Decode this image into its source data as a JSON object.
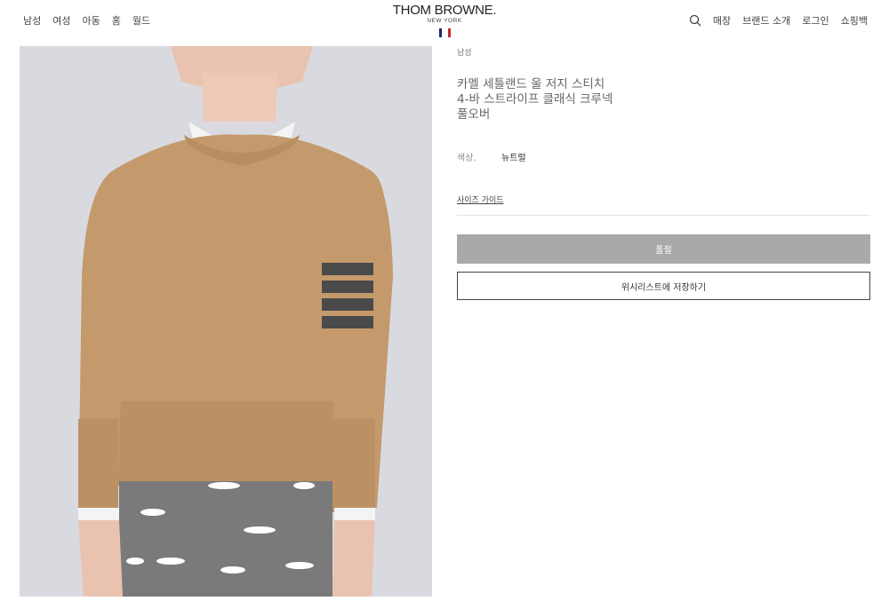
{
  "header": {
    "nav_left": [
      "남성",
      "여성",
      "아동",
      "홈",
      "월드"
    ],
    "logo": {
      "main": "THOM BROWNE.",
      "sub": "NEW YORK"
    },
    "flag_colors": [
      "#1d2a6d",
      "#ffffff",
      "#c1272d"
    ],
    "nav_right": {
      "stores": "매장",
      "brand": "브랜드 소개",
      "login": "로그인",
      "bag": "쇼핑백"
    }
  },
  "product": {
    "breadcrumb": "남성",
    "title_lines": [
      "카멜 세틀랜드 울 저지 스티치",
      "4-바 스트라이프 클래식 크루넥",
      "풀오버"
    ],
    "color_label": "색상.",
    "color_value": "뉴트럴",
    "size_guide": "사이즈 가이드",
    "soldout_label": "품절",
    "wishlist_label": "위시리스트에 저장하기"
  },
  "colors": {
    "image_background": "#d9dae0",
    "sweater": "#c49a6c",
    "stripe": "#4a4a4a",
    "trousers": "#7a7a7a",
    "soldout_button": "#a9a9ab"
  }
}
